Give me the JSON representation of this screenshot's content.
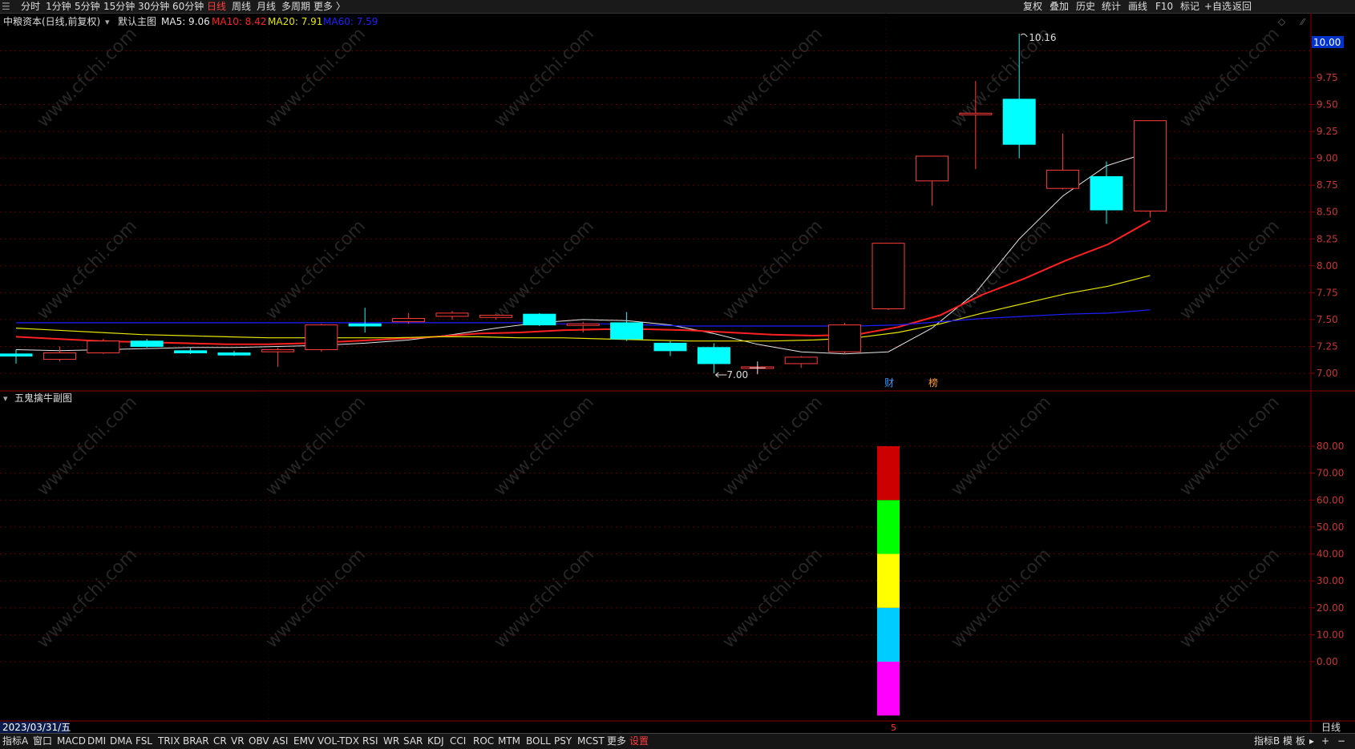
{
  "toolbar": {
    "corner_icon": "menu-icon",
    "periods": [
      "分时",
      "1分钟",
      "5分钟",
      "15分钟",
      "30分钟",
      "60分钟",
      "日线",
      "周线",
      "月线",
      "多周期",
      "更多 〉"
    ],
    "active_period": "日线",
    "right_items": [
      "复权",
      "叠加",
      "历史",
      "统计",
      "画线",
      "F10",
      "标记",
      "+自选",
      "返回"
    ]
  },
  "main_chart": {
    "header": {
      "stock": "中粮资本(日线,前复权)",
      "label": "默认主图",
      "ma5": "MA5: 9.06",
      "ma10": "MA10: 8.42",
      "ma20": "MA20: 7.91",
      "ma60": "MA60: 7.59"
    },
    "price_ticks": [
      "9.75",
      "9.50",
      "9.25",
      "9.00",
      "8.75",
      "8.50",
      "8.25",
      "8.00",
      "7.75",
      "7.50",
      "7.25",
      "7.00"
    ],
    "price_flag": "10.00",
    "high_label": "10.16",
    "low_label": "7.00",
    "event_markers": [
      "财",
      "榜"
    ],
    "colors": {
      "ma5": "#e6e6e6",
      "ma10": "#ff2020",
      "ma20": "#e6e600",
      "ma60": "#1e1eff",
      "up": "#ff3c3c",
      "down": "#00ffff"
    }
  },
  "chart_data": {
    "type": "candlestick",
    "ylim": [
      6.9,
      10.22
    ],
    "candles": [
      {
        "o": 7.18,
        "h": 7.22,
        "l": 7.09,
        "c": 7.16
      },
      {
        "o": 7.13,
        "h": 7.25,
        "l": 7.11,
        "c": 7.19
      },
      {
        "o": 7.19,
        "h": 7.32,
        "l": 7.18,
        "c": 7.3
      },
      {
        "o": 7.3,
        "h": 7.32,
        "l": 7.24,
        "c": 7.25
      },
      {
        "o": 7.21,
        "h": 7.24,
        "l": 7.18,
        "c": 7.19
      },
      {
        "o": 7.19,
        "h": 7.21,
        "l": 7.16,
        "c": 7.17
      },
      {
        "o": 7.2,
        "h": 7.24,
        "l": 7.06,
        "c": 7.22
      },
      {
        "o": 7.22,
        "h": 7.46,
        "l": 7.2,
        "c": 7.45
      },
      {
        "o": 7.46,
        "h": 7.61,
        "l": 7.38,
        "c": 7.44
      },
      {
        "o": 7.48,
        "h": 7.56,
        "l": 7.46,
        "c": 7.51
      },
      {
        "o": 7.53,
        "h": 7.58,
        "l": 7.5,
        "c": 7.56
      },
      {
        "o": 7.52,
        "h": 7.55,
        "l": 7.5,
        "c": 7.54
      },
      {
        "o": 7.55,
        "h": 7.56,
        "l": 7.44,
        "c": 7.45
      },
      {
        "o": 7.45,
        "h": 7.48,
        "l": 7.38,
        "c": 7.46
      },
      {
        "o": 7.47,
        "h": 7.57,
        "l": 7.3,
        "c": 7.32
      },
      {
        "o": 7.28,
        "h": 7.3,
        "l": 7.16,
        "c": 7.21
      },
      {
        "o": 7.24,
        "h": 7.28,
        "l": 7.0,
        "c": 7.09
      },
      {
        "o": 7.05,
        "h": 7.08,
        "l": 7.0,
        "c": 7.06
      },
      {
        "o": 7.09,
        "h": 7.16,
        "l": 7.05,
        "c": 7.15
      },
      {
        "o": 7.2,
        "h": 7.47,
        "l": 7.18,
        "c": 7.45
      },
      {
        "o": 7.6,
        "h": 8.21,
        "l": 7.59,
        "c": 8.21
      },
      {
        "o": 8.79,
        "h": 9.02,
        "l": 8.56,
        "c": 9.02
      },
      {
        "o": 9.41,
        "h": 9.72,
        "l": 8.9,
        "c": 9.42
      },
      {
        "o": 9.55,
        "h": 10.16,
        "l": 9.0,
        "c": 9.13
      },
      {
        "o": 8.72,
        "h": 9.23,
        "l": 8.71,
        "c": 8.89
      },
      {
        "o": 8.83,
        "h": 8.97,
        "l": 8.39,
        "c": 8.52
      },
      {
        "o": 8.51,
        "h": 9.35,
        "l": 8.45,
        "c": 9.35
      }
    ],
    "series": [
      {
        "name": "MA5",
        "values": [
          7.22,
          7.21,
          7.22,
          7.23,
          7.24,
          7.24,
          7.25,
          7.26,
          7.28,
          7.31,
          7.36,
          7.42,
          7.47,
          7.5,
          7.49,
          7.45,
          7.37,
          7.27,
          7.2,
          7.18,
          7.2,
          7.42,
          7.75,
          8.25,
          8.65,
          8.93,
          9.06
        ]
      },
      {
        "name": "MA10",
        "values": [
          7.34,
          7.32,
          7.3,
          7.29,
          7.28,
          7.27,
          7.27,
          7.28,
          7.3,
          7.32,
          7.34,
          7.37,
          7.38,
          7.4,
          7.41,
          7.41,
          7.4,
          7.38,
          7.36,
          7.35,
          7.36,
          7.43,
          7.54,
          7.73,
          7.88,
          8.05,
          8.2,
          8.42
        ]
      },
      {
        "name": "MA20",
        "values": [
          7.42,
          7.4,
          7.38,
          7.36,
          7.35,
          7.34,
          7.33,
          7.33,
          7.33,
          7.33,
          7.34,
          7.34,
          7.33,
          7.33,
          7.32,
          7.31,
          7.3,
          7.3,
          7.3,
          7.31,
          7.33,
          7.38,
          7.46,
          7.56,
          7.65,
          7.74,
          7.81,
          7.91
        ]
      },
      {
        "name": "MA60",
        "values": [
          7.47,
          7.47,
          7.47,
          7.47,
          7.47,
          7.47,
          7.47,
          7.47,
          7.47,
          7.47,
          7.47,
          7.47,
          7.47,
          7.46,
          7.46,
          7.45,
          7.44,
          7.44,
          7.44,
          7.44,
          7.44,
          7.45,
          7.48,
          7.51,
          7.53,
          7.55,
          7.56,
          7.59
        ]
      }
    ]
  },
  "sub_chart": {
    "title": "五鬼擒牛副图",
    "ticks": [
      "80.00",
      "70.00",
      "60.00",
      "50.00",
      "40.00",
      "30.00",
      "20.00",
      "10.00",
      "0.00"
    ],
    "ylim": [
      -20,
      90
    ],
    "bar_segments": [
      {
        "from": -20,
        "to": 0,
        "color": "#ff00ff"
      },
      {
        "from": 0,
        "to": 20,
        "color": "#00ccff"
      },
      {
        "from": 20,
        "to": 40,
        "color": "#ffff00"
      },
      {
        "from": 40,
        "to": 60,
        "color": "#00ff00"
      },
      {
        "from": 60,
        "to": 80,
        "color": "#cc0000"
      }
    ]
  },
  "axis": {
    "date": "2023/03/31/五",
    "month_marker": "5",
    "period_label": "日线"
  },
  "watermark": "www.cfchi.com",
  "bottom_bar": {
    "items": [
      "指标A",
      "窗口",
      "MACD",
      "DMI",
      "DMA",
      "FSL",
      "TRIX",
      "BRAR",
      "CR",
      "VR",
      "OBV",
      "ASI",
      "EMV",
      "VOL-TDX",
      "RSI",
      "WR",
      "SAR",
      "KDJ",
      "CCI",
      "ROC",
      "MTM",
      "BOLL",
      "PSY",
      "MCST",
      "更多",
      "设置"
    ],
    "active": "设置",
    "right_items": [
      "指标B",
      "模",
      "板",
      "▸",
      "+",
      "−"
    ]
  }
}
